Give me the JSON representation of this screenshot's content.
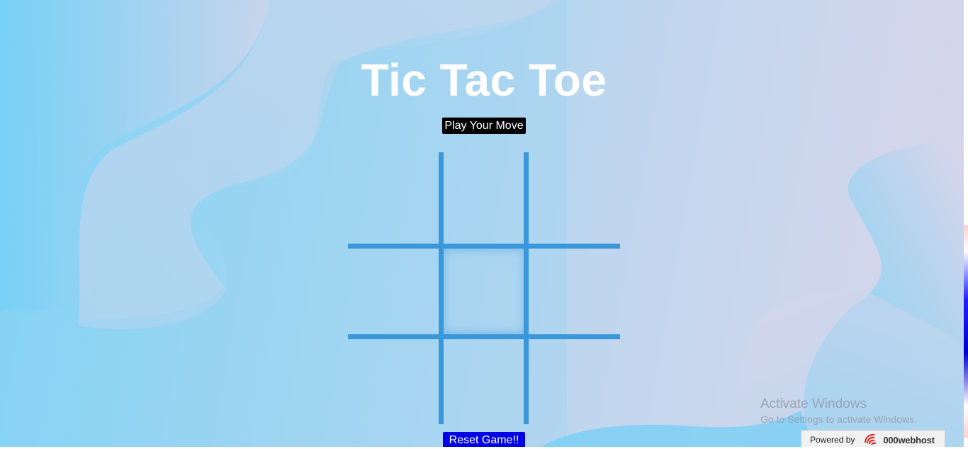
{
  "page": {
    "title": "Tic Tac Toe",
    "status_label": "Play Your Move",
    "reset_label": "Reset Game!!"
  },
  "board": {
    "cells": [
      "",
      "",
      "",
      "",
      "",
      "",
      "",
      "",
      ""
    ]
  },
  "watermark": {
    "title": "Activate Windows",
    "subtitle": "Go to Settings to activate Windows."
  },
  "badge": {
    "prefix": "Powered by",
    "brand": "000webhost",
    "icon": "000webhost-logo-icon"
  },
  "colors": {
    "grid_lines": "#3a97d9",
    "status_bg": "#000000",
    "reset_bg": "#0000e6",
    "title": "#ffffff"
  }
}
